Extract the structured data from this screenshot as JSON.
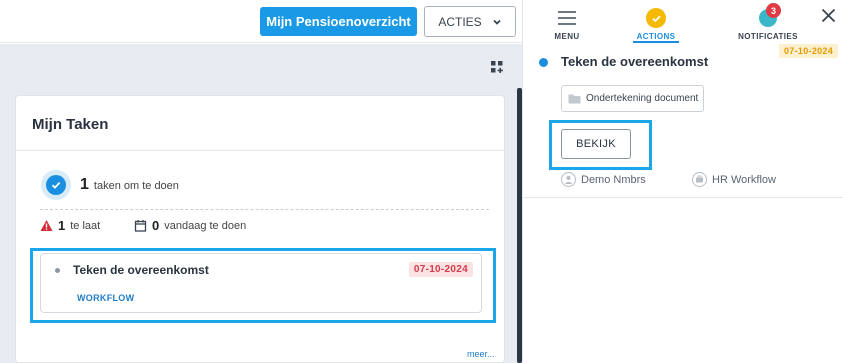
{
  "topbar": {
    "primary_button": "Mijn Pensioenoverzicht",
    "acties_button": "ACTIES"
  },
  "tasks_card": {
    "title": "Mijn Taken",
    "todo_count": "1",
    "todo_label": "taken om te doen",
    "late_count": "1",
    "late_label": "te laat",
    "today_count": "0",
    "today_label": "vandaag te doen",
    "task": {
      "title": "Teken de overeenkomst",
      "date": "07-10-2024",
      "type": "WORKFLOW"
    },
    "more_link": "meer..."
  },
  "right_panel": {
    "tabs": [
      {
        "label": "MENU",
        "icon": "hamburger-icon",
        "active": false
      },
      {
        "label": "ACTIONS",
        "icon": "check-circle-icon",
        "active": true
      },
      {
        "label": "NOTIFICATIES",
        "icon": "notification-icon",
        "active": false,
        "badge": "3"
      }
    ],
    "action": {
      "date": "07-10-2024",
      "title": "Teken de overeenkomst",
      "document_label": "Ondertekening document",
      "view_button": "BEKIJK",
      "owner": "Demo Nmbrs",
      "workflow": "HR Workflow"
    }
  },
  "colors": {
    "primary": "#1a9ae6",
    "highlight": "#1aa6ea",
    "late_badge_bg": "#fbe3e4",
    "late_badge_text": "#d43a4a",
    "date_badge_bg": "#fdf0cf",
    "date_badge_text": "#e39b00",
    "actions_icon": "#f5b900",
    "notification_badge": "#e03a45"
  }
}
